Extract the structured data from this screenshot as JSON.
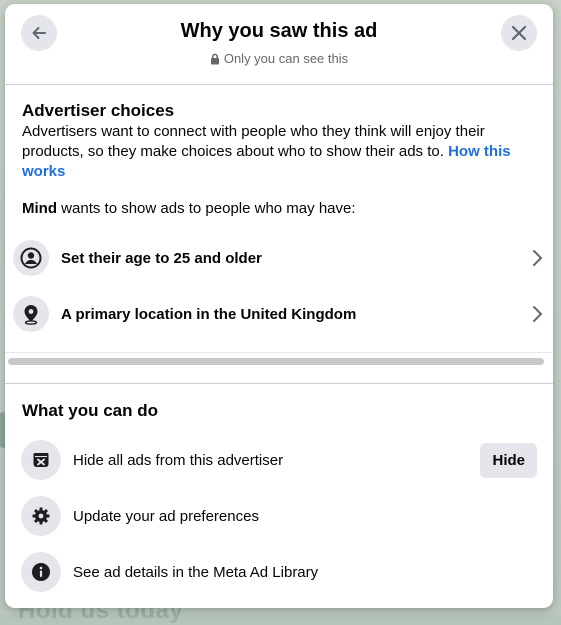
{
  "background": {
    "text": "Hold us today"
  },
  "header": {
    "title": "Why you saw this ad",
    "subtitle": "Only you can see this"
  },
  "advertiser_choices": {
    "title": "Advertiser choices",
    "text": "Advertisers want to connect with people who they think will enjoy their products, so they make choices about who to show their ads to.",
    "link": "How this works",
    "advertiser": "Mind",
    "wants_text": "wants to show ads to people who may have:",
    "items": [
      {
        "label": "Set their age to 25 and older",
        "icon": "person-circle-icon"
      },
      {
        "label": "A primary location in the United Kingdom",
        "icon": "location-pin-icon"
      }
    ]
  },
  "what_you_can_do": {
    "title": "What you can do",
    "items": [
      {
        "label": "Hide all ads from this advertiser",
        "icon": "hide-ad-icon",
        "button": "Hide"
      },
      {
        "label": "Update your ad preferences",
        "icon": "gear-icon"
      },
      {
        "label": "See ad details in the Meta Ad Library",
        "icon": "info-icon"
      }
    ]
  },
  "colors": {
    "link": "#216fdb",
    "button_bg": "#e4e6eb",
    "text": "#050505",
    "muted": "#65676b"
  }
}
